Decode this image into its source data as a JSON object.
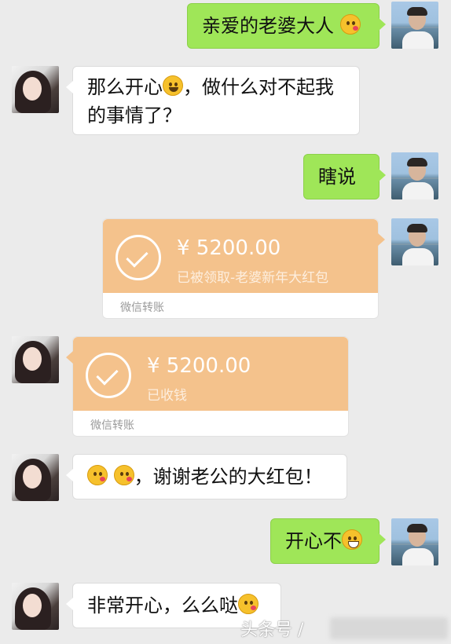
{
  "messages": {
    "m1": {
      "text": "亲爱的老婆大人",
      "emoji": "kiss-emoji"
    },
    "m2": {
      "line1": "那么开心",
      "line1_after": "，做什么对不起我",
      "line2": "的事情了？",
      "emoji": "smile-emoji"
    },
    "m3": {
      "text": "瞎说"
    },
    "m6": {
      "text": "，谢谢老公的大红包！",
      "emoji": "kiss-emoji"
    },
    "m7": {
      "text": "开心不",
      "emoji": "grin-emoji"
    },
    "m8": {
      "text": "非常开心，么么哒",
      "emoji": "kiss-emoji"
    }
  },
  "transfers": {
    "sent": {
      "amount": "¥ 5200.00",
      "status": "已被领取-老婆新年大红包",
      "footer": "微信转账"
    },
    "received": {
      "amount": "¥ 5200.00",
      "status": "已收钱",
      "footer": "微信转账"
    }
  },
  "watermark": {
    "text": "头条号 /"
  },
  "colors": {
    "green_bubble": "#9fe658",
    "transfer_orange": "#f4c28c",
    "background": "#ebebeb"
  }
}
